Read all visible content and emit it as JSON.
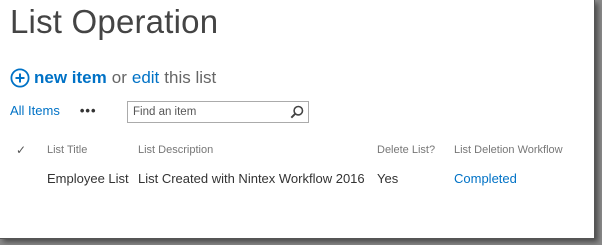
{
  "page": {
    "title": "List Operation"
  },
  "command_bar": {
    "new_item_label": "new item",
    "or_text": "or",
    "edit_label": "edit",
    "this_list_text": "this list"
  },
  "views": {
    "current_view": "All Items",
    "more_label": "•••"
  },
  "search": {
    "placeholder": "Find an item"
  },
  "table": {
    "check_glyph": "✓",
    "columns": [
      "List Title",
      "List Description",
      "Delete List?",
      "List Deletion Workflow"
    ],
    "rows": [
      {
        "list_title": "Employee List",
        "list_description": "List Created with Nintex Workflow 2016",
        "delete_list": "Yes",
        "workflow_status": "Completed"
      }
    ]
  },
  "colors": {
    "accent": "#0072c6",
    "title_text": "#444444",
    "header_text": "#777777"
  }
}
